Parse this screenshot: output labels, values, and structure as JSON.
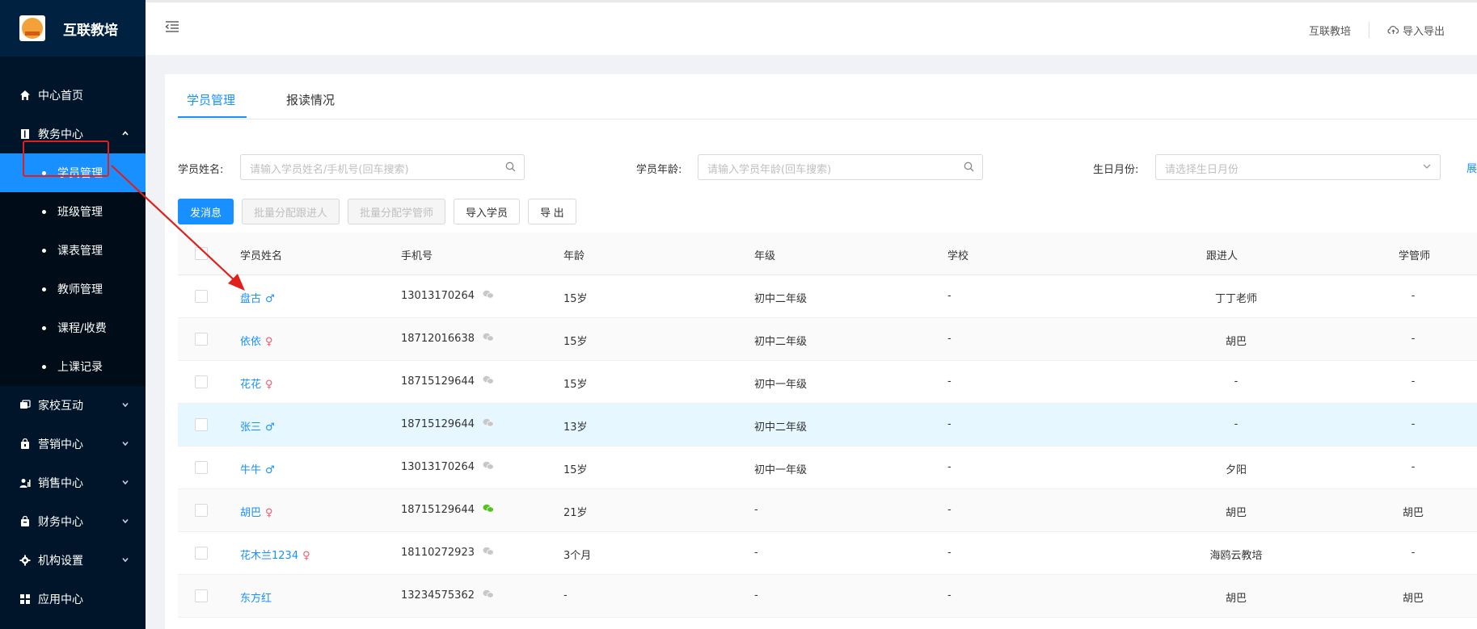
{
  "brand": {
    "title": "互联教培",
    "logo_icon": "brand-logo"
  },
  "sidebar": {
    "items": [
      {
        "label": "中心首页",
        "icon": "home-icon"
      },
      {
        "label": "教务中心",
        "icon": "book-icon",
        "expanded": true,
        "children": [
          "学员管理",
          "班级管理",
          "课表管理",
          "教师管理",
          "课程/收费",
          "上课记录"
        ]
      },
      {
        "label": "家校互动",
        "icon": "chat-icon"
      },
      {
        "label": "营销中心",
        "icon": "bag-icon"
      },
      {
        "label": "销售中心",
        "icon": "user-chart-icon"
      },
      {
        "label": "财务中心",
        "icon": "wallet-icon"
      },
      {
        "label": "机构设置",
        "icon": "gear-icon"
      },
      {
        "label": "应用中心",
        "icon": "grid-icon"
      }
    ],
    "active_child": "学员管理"
  },
  "header": {
    "org": "互联教培",
    "import_export": "导入导出"
  },
  "tabs": [
    "学员管理",
    "报读情况"
  ],
  "filters": {
    "name_label": "学员姓名:",
    "name_placeholder": "请输入学员姓名/手机号(回车搜索)",
    "age_label": "学员年龄:",
    "age_placeholder": "请输入学员年龄(回车搜索)",
    "birth_label": "生日月份:",
    "birth_placeholder": "请选择生日月份",
    "extra": "展"
  },
  "actions": {
    "send": "发消息",
    "assign_follower": "批量分配跟进人",
    "assign_manager": "批量分配学管师",
    "import": "导入学员",
    "export": "导 出"
  },
  "table": {
    "columns": [
      "学员姓名",
      "手机号",
      "年龄",
      "年级",
      "学校",
      "跟进人",
      "学管师"
    ],
    "rows": [
      {
        "name": "盘古",
        "gender": "♂",
        "phone": "13013170264",
        "wechat": false,
        "age": "15岁",
        "grade": "初中二年级",
        "school": "-",
        "follower": "丁丁老师",
        "manager": "-"
      },
      {
        "name": "依依",
        "gender": "♀",
        "phone": "18712016638",
        "wechat": false,
        "age": "15岁",
        "grade": "初中二年级",
        "school": "-",
        "follower": "胡巴",
        "manager": "-"
      },
      {
        "name": "花花",
        "gender": "♀",
        "phone": "18715129644",
        "wechat": false,
        "age": "15岁",
        "grade": "初中一年级",
        "school": "-",
        "follower": "-",
        "manager": "-"
      },
      {
        "name": "张三",
        "gender": "♂",
        "phone": "18715129644",
        "wechat": false,
        "age": "13岁",
        "grade": "初中二年级",
        "school": "-",
        "follower": "-",
        "manager": "-"
      },
      {
        "name": "牛牛",
        "gender": "♂",
        "phone": "13013170264",
        "wechat": false,
        "age": "15岁",
        "grade": "初中一年级",
        "school": "-",
        "follower": "夕阳",
        "manager": "-"
      },
      {
        "name": "胡巴",
        "gender": "♀",
        "phone": "18715129644",
        "wechat": true,
        "age": "21岁",
        "grade": "-",
        "school": "-",
        "follower": "胡巴",
        "manager": "胡巴"
      },
      {
        "name": "花木兰1234",
        "gender": "♀",
        "phone": "18110272923",
        "wechat": false,
        "age": "3个月",
        "grade": "-",
        "school": "-",
        "follower": "海鸥云教培",
        "manager": "-"
      },
      {
        "name": "东方红",
        "gender": "",
        "phone": "13234575362",
        "wechat": false,
        "age": "-",
        "grade": "-",
        "school": "-",
        "follower": "胡巴",
        "manager": "胡巴"
      }
    ]
  },
  "colors": {
    "primary": "#1890ff",
    "sidebar": "#001529",
    "annotation": "#e0201d",
    "wechat_active": "#52c41a",
    "wechat_inactive": "#c8c8c8"
  }
}
